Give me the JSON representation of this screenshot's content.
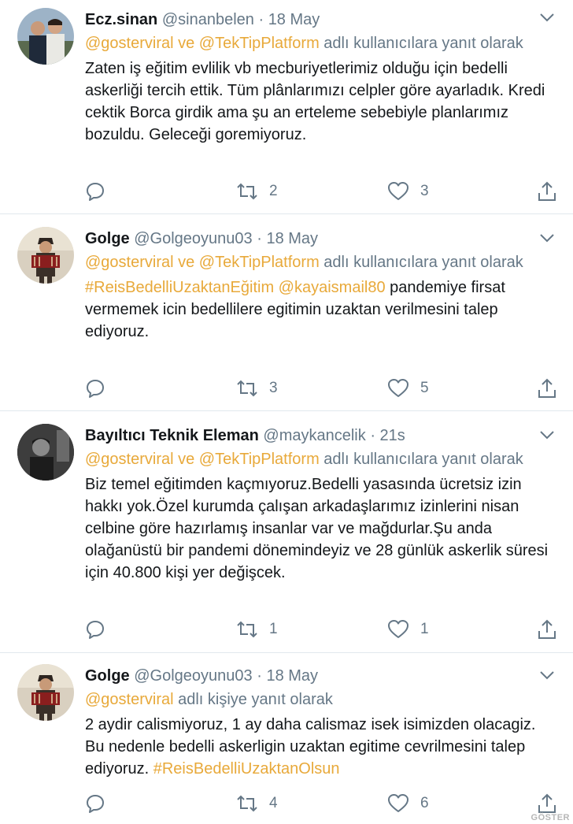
{
  "tweets": [
    {
      "name": "Ecz.sinan",
      "handle": "@sinanbelen",
      "dot": "·",
      "time": "18 May",
      "reply_mentions": "@gosterviral ve @TekTipPlatform",
      "reply_suffix": " adlı kullanıcılara yanıt olarak",
      "text": "Zaten iş eğitim evlilik vb mecburiyetlerimiz olduğu için bedelli askerliği tercih ettik. Tüm plânlarımızı celpler göre ayarladık.  Kredi cektik Borca girdik ama şu an erteleme sebebiyle planlarımız bozuldu. Geleceği goremiyoruz.",
      "retweets": "2",
      "likes": "3",
      "avatar_icon": "user-photo"
    },
    {
      "name": "Golge",
      "handle": "@Golgeoyunu03",
      "dot": "·",
      "time": "18 May",
      "reply_mentions": "@gosterviral ve @TekTipPlatform",
      "reply_suffix": " adlı kullanıcılara yanıt olarak",
      "text_hashtag": "#ReisBedelliUzaktanEğitim",
      "text_mention": "@kayaismail80",
      "text_rest": " pandemiye firsat vermemek icin bedellilere egitimin uzaktan verilmesini talep ediyoruz.",
      "retweets": "3",
      "likes": "5",
      "avatar_icon": "accordion-player-photo"
    },
    {
      "name": "Bayıltıcı Teknik Eleman",
      "handle": "@maykancelik",
      "dot": "·",
      "time": "21s",
      "reply_mentions": "@gosterviral ve @TekTipPlatform",
      "reply_suffix": " adlı kullanıcılara yanıt olarak",
      "text": "Biz temel eğitimden kaçmıyoruz.Bedelli yasasında ücretsiz izin hakkı yok.Özel kurumda çalışan arkadaşlarımız izinlerini nisan celbine göre hazırlamış insanlar var ve mağdurlar.Şu anda olağanüstü bir pandemi dönemindeyiz ve 28 günlük askerlik süresi için 40.800 kişi yer değişcek.",
      "retweets": "1",
      "likes": "1",
      "avatar_icon": "dark-portrait-photo"
    },
    {
      "name": "Golge",
      "handle": "@Golgeoyunu03",
      "dot": "·",
      "time": "18 May",
      "reply_mentions": "@gosterviral",
      "reply_suffix": " adlı kişiye yanıt olarak",
      "text": "2 aydir calismiyoruz, 1 ay daha calismaz isek isimizden olacagiz. Bu nedenle bedelli askerligin uzaktan egitime cevrilmesini talep ediyoruz. ",
      "text_hashtag": "#ReisBedelliUzaktanOlsun",
      "retweets": "4",
      "likes": "6",
      "avatar_icon": "accordion-player-photo"
    }
  ],
  "watermark": "GÖSTER",
  "colors": {
    "link": "#e8a93a",
    "muted": "#657786",
    "divider": "#e1e8ed"
  }
}
